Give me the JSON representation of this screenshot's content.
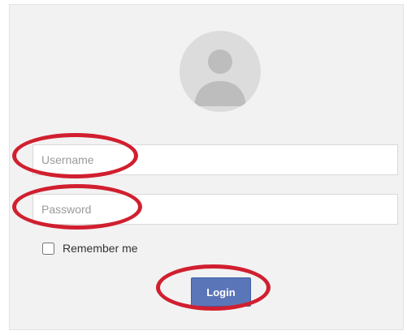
{
  "login_form": {
    "username": {
      "placeholder": "Username",
      "value": ""
    },
    "password": {
      "placeholder": "Password",
      "value": ""
    },
    "remember_me": {
      "label": "Remember me",
      "checked": false
    },
    "login_button": {
      "label": "Login"
    }
  },
  "icons": {
    "avatar": "user-avatar-icon"
  },
  "colors": {
    "card_background": "#f2f2f2",
    "button_background": "#5b76b8",
    "annotation_red": "#d11f2f"
  }
}
